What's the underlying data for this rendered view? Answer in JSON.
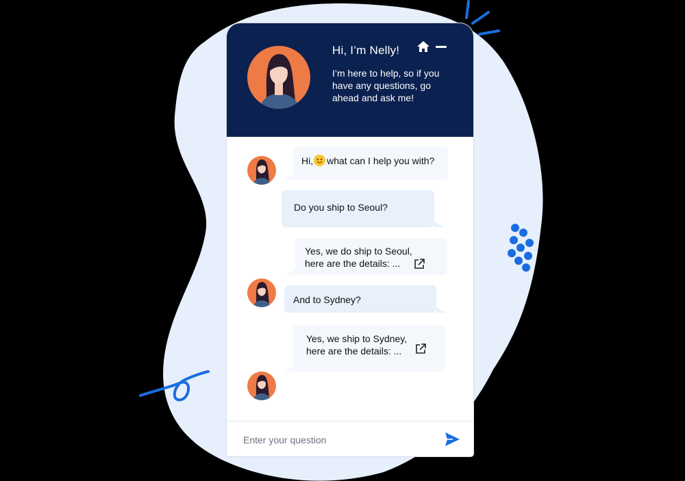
{
  "header": {
    "title": "Hi, I’m Nelly!",
    "intro": "I’m here to help, so if you have any questions, go ahead and ask me!",
    "home_icon": "home-icon",
    "minimize_icon": "minimize-icon"
  },
  "messages": [
    {
      "sender": "bot",
      "before_emoji": "Hi,",
      "emoji": "smile-emoji",
      "after_emoji": "what can I help you with?"
    },
    {
      "sender": "user",
      "text": "Do you ship to Seoul?"
    },
    {
      "sender": "bot",
      "line1": "Yes, we do ship to Seoul,",
      "line2": "here are the details: ...",
      "link_icon": "external-link-icon"
    },
    {
      "sender": "user",
      "text": "And to Sydney?"
    },
    {
      "sender": "bot",
      "line1": "Yes, we ship to Sydney,",
      "line2": "here are the details: ...",
      "link_icon": "external-link-icon"
    }
  ],
  "composer": {
    "placeholder": "Enter your question",
    "send_icon": "send-icon"
  },
  "colors": {
    "header_bg": "#0b2150",
    "accent": "#1a6de0",
    "avatar_bg": "#ee7a45",
    "bot_bubble": "#f4f7fb",
    "user_bubble": "#e8f0fb"
  }
}
